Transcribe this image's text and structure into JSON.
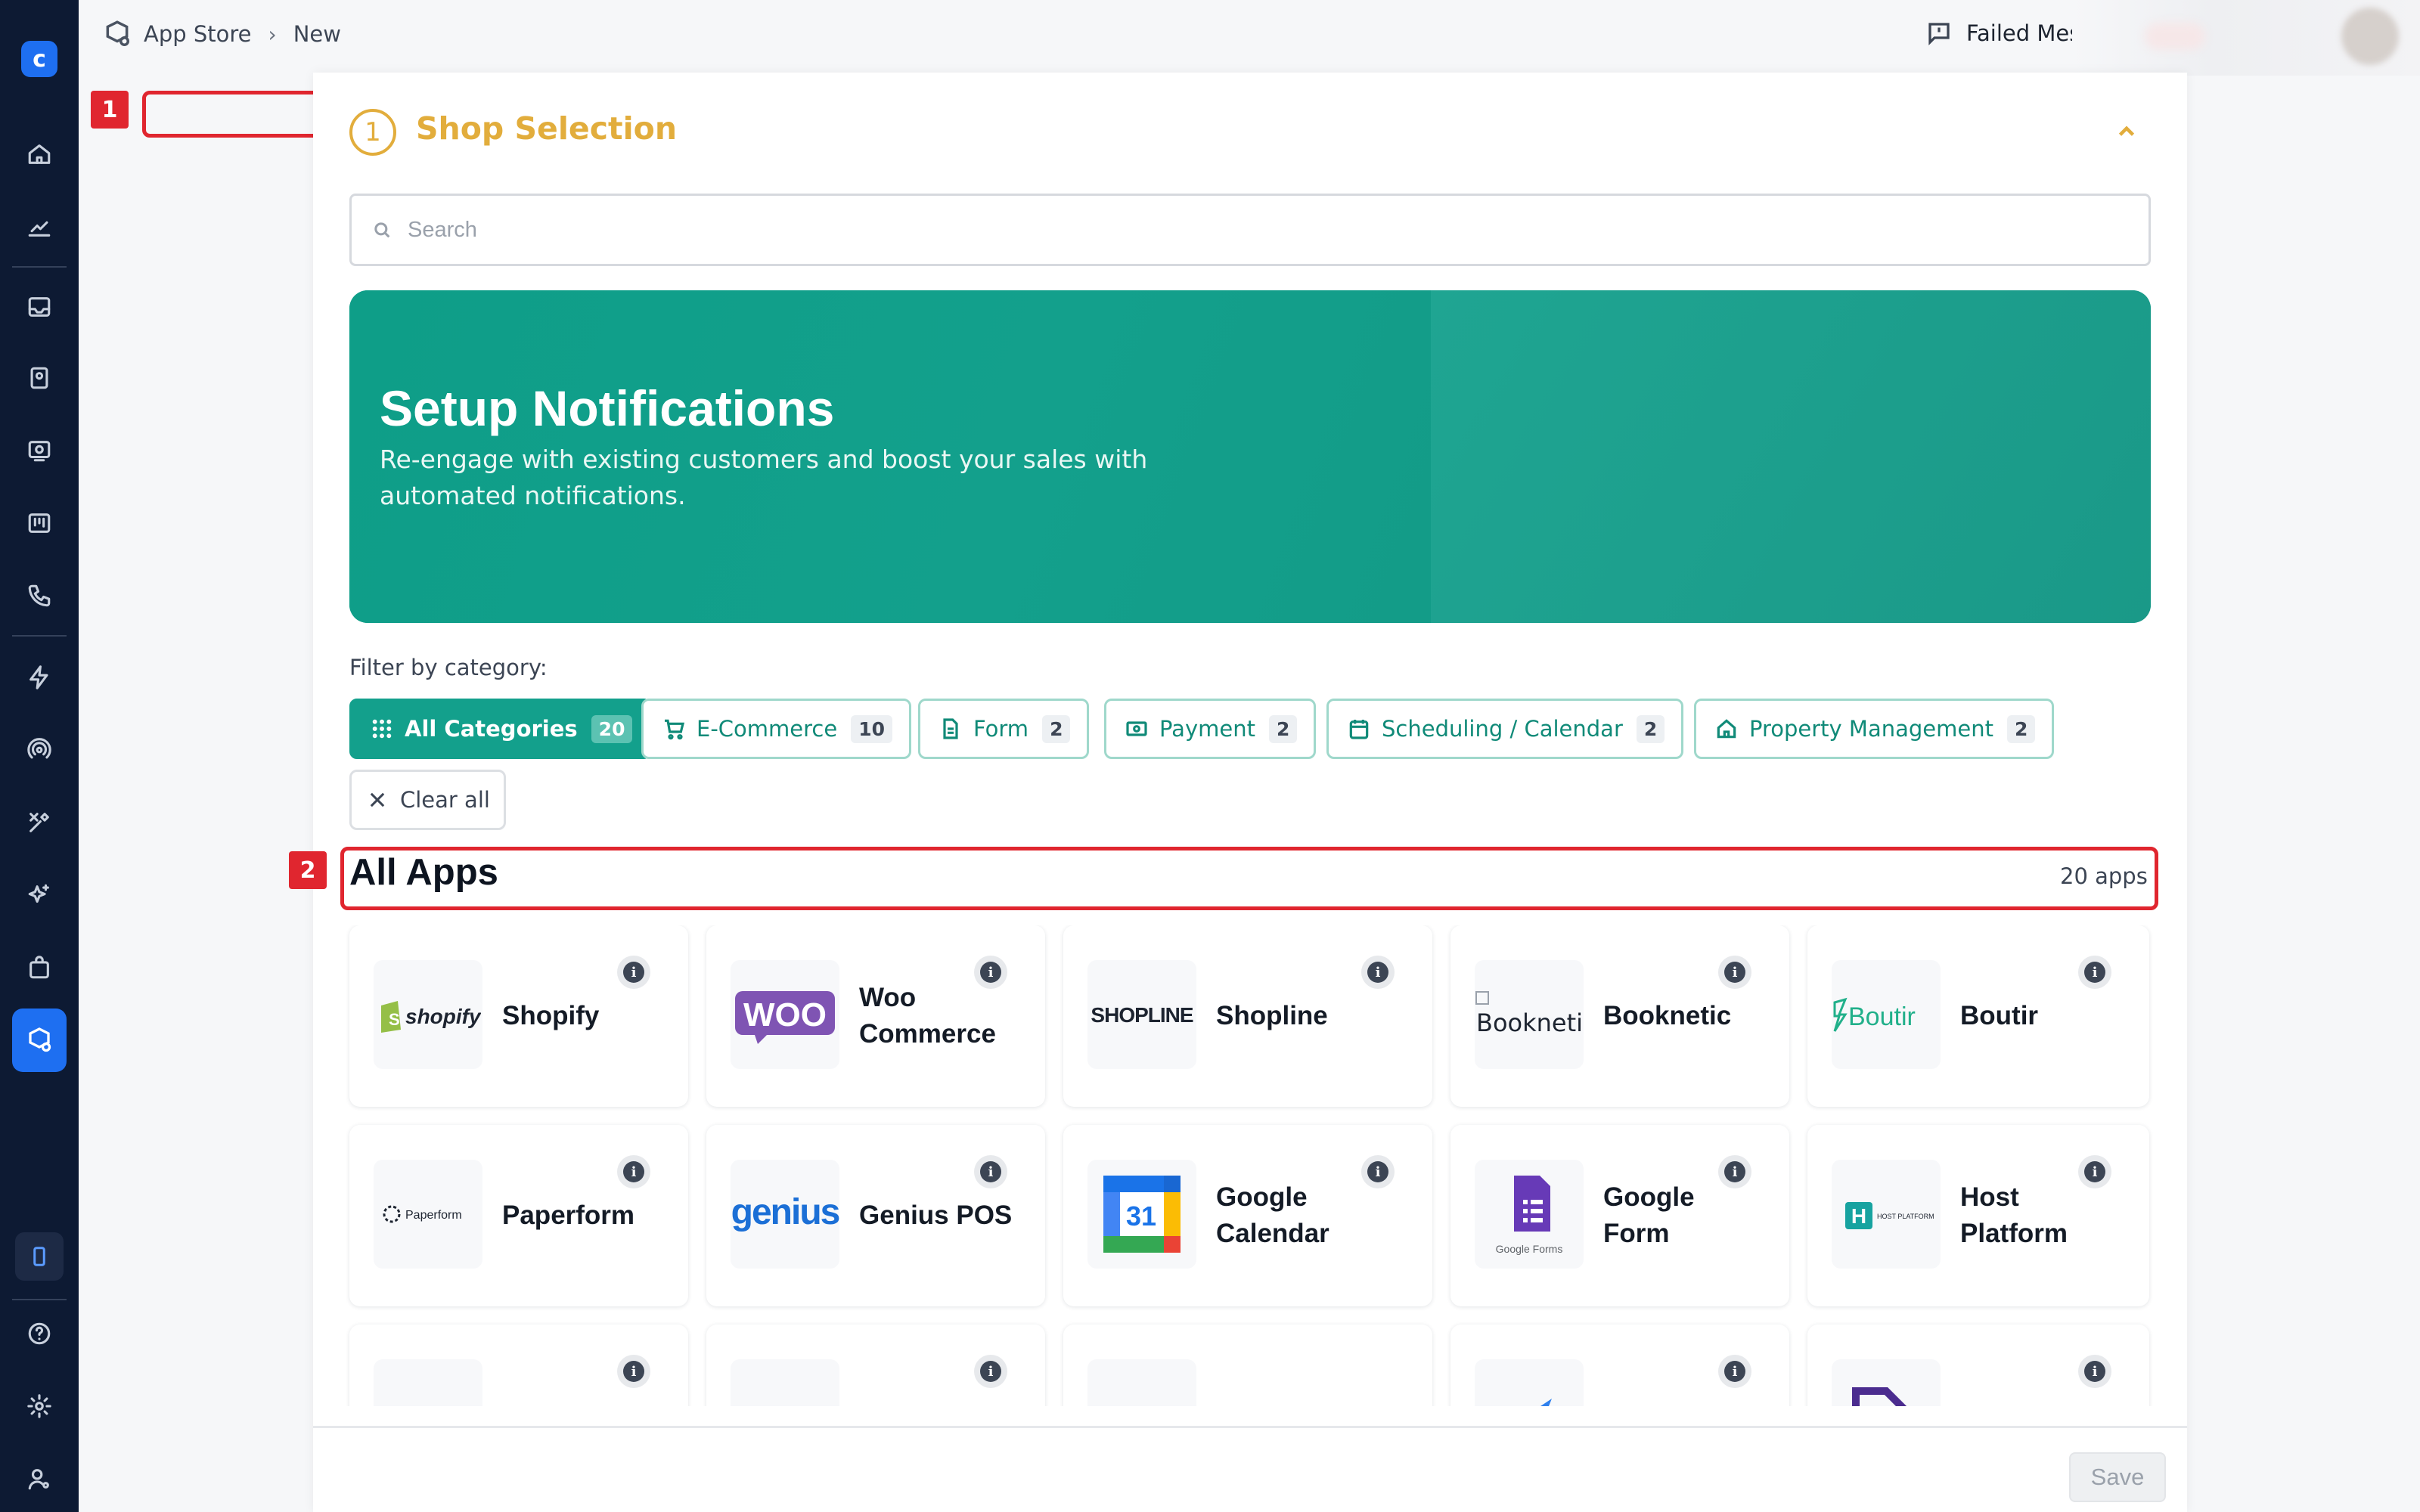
{
  "breadcrumb": {
    "root": "App Store",
    "separator": "›",
    "current": "New"
  },
  "header": {
    "failed_messages": "Failed Messages"
  },
  "markers": {
    "m1": "1",
    "m2": "2"
  },
  "step": {
    "number": "1",
    "title": "Shop Selection"
  },
  "search": {
    "placeholder": "Search",
    "value": ""
  },
  "banner": {
    "title": "Setup Notifications",
    "text": "Re-engage with existing customers and boost your sales with automated notifications."
  },
  "filter": {
    "label": "Filter by category:",
    "chips": [
      {
        "label": "All Categories",
        "count": "20",
        "icon": "grid-icon",
        "active": true
      },
      {
        "label": "E-Commerce",
        "count": "10",
        "icon": "cart-icon",
        "active": false
      },
      {
        "label": "Form",
        "count": "2",
        "icon": "document-icon",
        "active": false
      },
      {
        "label": "Payment",
        "count": "2",
        "icon": "cash-icon",
        "active": false
      },
      {
        "label": "Scheduling / Calendar",
        "count": "2",
        "icon": "calendar-icon",
        "active": false
      },
      {
        "label": "Property Management",
        "count": "2",
        "icon": "house-icon",
        "active": false
      }
    ],
    "clear_label": "Clear all"
  },
  "apps": {
    "title": "All Apps",
    "count_label": "20 apps",
    "items": [
      {
        "name": "Shopify",
        "logo_text": "shopify",
        "logo_color": "#1d2430"
      },
      {
        "name": "Woo Commerce",
        "logo_text": "WOO",
        "logo_color": "#7f54b3"
      },
      {
        "name": "Shopline",
        "logo_text": "SHOPLINE",
        "logo_color": "#1d2430"
      },
      {
        "name": "Booknetic",
        "logo_text": "Booknetic",
        "logo_color": "#1d2430"
      },
      {
        "name": "Boutir",
        "logo_text": "Boutir",
        "logo_color": "#21b08a"
      },
      {
        "name": "Paperform",
        "logo_text": "Paperform",
        "logo_color": "#1d2430"
      },
      {
        "name": "Genius POS",
        "logo_text": "genius",
        "logo_color": "#1b6fd6"
      },
      {
        "name": "Google Calendar",
        "logo_text": "31",
        "logo_color": "#1a73e8"
      },
      {
        "name": "Google Form",
        "logo_text": "Google Forms",
        "logo_color": "#673ab7"
      },
      {
        "name": "Host Platform",
        "logo_text": "HOST PLATFORM",
        "logo_color": "#17a3a0"
      }
    ]
  },
  "footer": {
    "save_label": "Save"
  },
  "colors": {
    "accent": "#13a08c",
    "step": "#e2ad3c",
    "rail": "#0d1a33",
    "highlight": "#e0262f"
  }
}
